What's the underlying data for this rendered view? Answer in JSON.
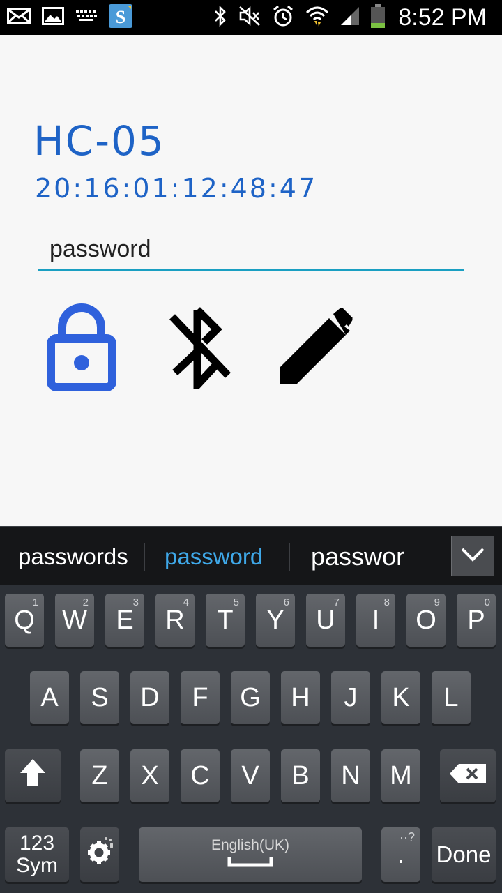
{
  "status_bar": {
    "time": "8:52 PM",
    "left_icons": [
      "email-icon",
      "image-icon",
      "keyboard-icon",
      "s-app-icon"
    ],
    "right_icons": [
      "bluetooth-icon",
      "mute-icon",
      "alarm-icon",
      "wifi-icon",
      "signal-icon",
      "battery-icon"
    ]
  },
  "device": {
    "name": "HC-05",
    "address": "20:16:01:12:48:47"
  },
  "password_field": {
    "value": "password"
  },
  "actions": [
    "lock-icon",
    "bluetooth-disabled-icon",
    "edit-icon"
  ],
  "keyboard": {
    "suggestions": [
      "passwords",
      "password",
      "passwor"
    ],
    "row1": [
      {
        "k": "Q",
        "n": "1"
      },
      {
        "k": "W",
        "n": "2"
      },
      {
        "k": "E",
        "n": "3"
      },
      {
        "k": "R",
        "n": "4"
      },
      {
        "k": "T",
        "n": "5"
      },
      {
        "k": "Y",
        "n": "6"
      },
      {
        "k": "U",
        "n": "7"
      },
      {
        "k": "I",
        "n": "8"
      },
      {
        "k": "O",
        "n": "9"
      },
      {
        "k": "P",
        "n": "0"
      }
    ],
    "row2": [
      "A",
      "S",
      "D",
      "F",
      "G",
      "H",
      "J",
      "K",
      "L"
    ],
    "row3": [
      "Z",
      "X",
      "C",
      "V",
      "B",
      "N",
      "M"
    ],
    "sym_top": "123",
    "sym_bottom": "Sym",
    "language": "English(UK)",
    "period": ".",
    "done": "Done",
    "accent_color": "#3fa8e8",
    "title_color": "#1e63c6"
  }
}
